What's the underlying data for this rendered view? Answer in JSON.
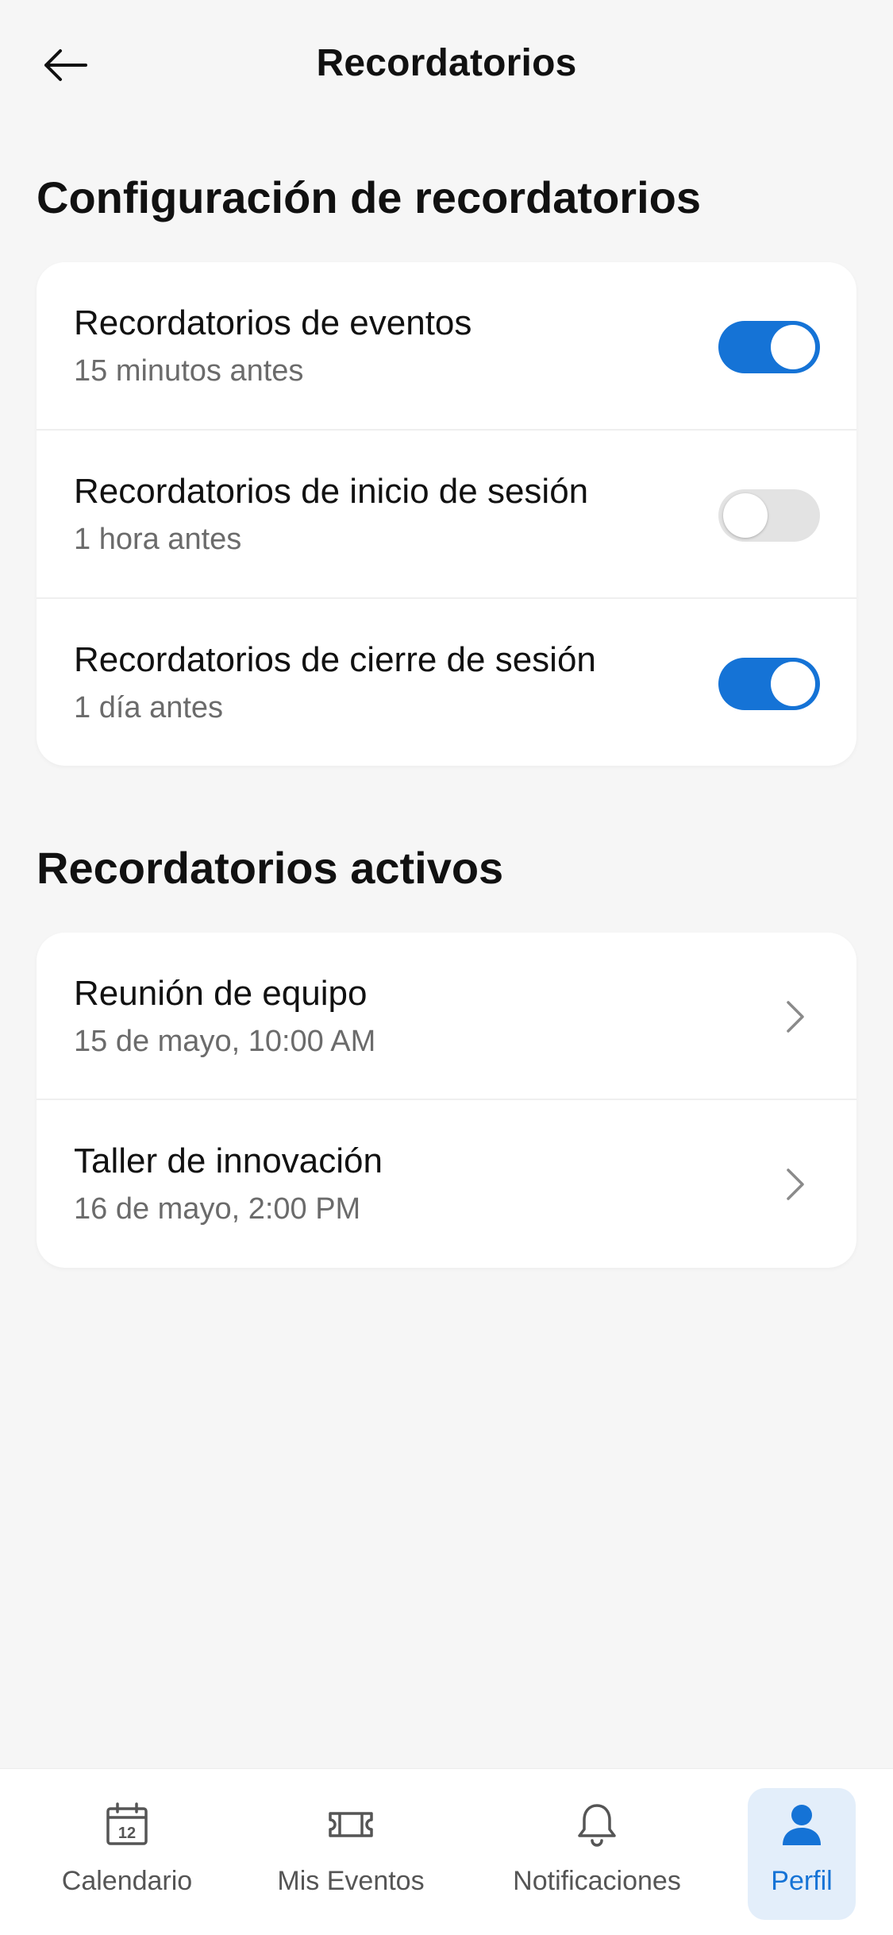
{
  "header": {
    "title": "Recordatorios"
  },
  "settings_section": {
    "title": "Configuración de recordatorios",
    "items": [
      {
        "title": "Recordatorios de eventos",
        "subtitle": "15 minutos antes",
        "enabled": true
      },
      {
        "title": "Recordatorios de inicio de sesión",
        "subtitle": "1 hora antes",
        "enabled": false
      },
      {
        "title": "Recordatorios de cierre de sesión",
        "subtitle": "1 día antes",
        "enabled": true
      }
    ]
  },
  "active_section": {
    "title": "Recordatorios activos",
    "items": [
      {
        "title": "Reunión de equipo",
        "subtitle": "15 de mayo, 10:00 AM"
      },
      {
        "title": "Taller de innovación",
        "subtitle": "16 de mayo, 2:00 PM"
      }
    ]
  },
  "bottom_nav": {
    "items": [
      {
        "label": "Calendario",
        "icon": "calendar-icon",
        "calendar_day": "12",
        "active": false
      },
      {
        "label": "Mis Eventos",
        "icon": "ticket-icon",
        "active": false
      },
      {
        "label": "Notificaciones",
        "icon": "bell-icon",
        "active": false
      },
      {
        "label": "Perfil",
        "icon": "person-icon",
        "active": true
      }
    ]
  },
  "colors": {
    "accent": "#1573d6",
    "toggle_off": "#e3e3e3",
    "background": "#f6f6f6",
    "active_tab_bg": "#e3eefa"
  }
}
